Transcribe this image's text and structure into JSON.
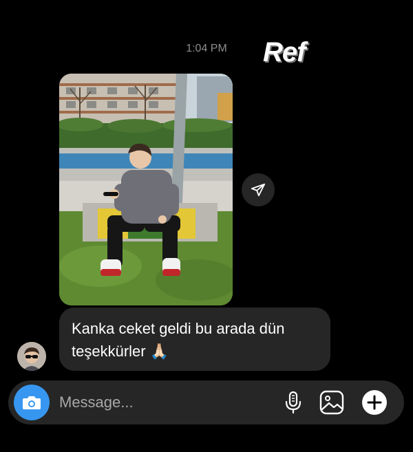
{
  "thread": {
    "timestamp": "1:04 PM",
    "sticker_text": "Ref",
    "shared_post": {
      "type": "photo",
      "share_icon": "paper-plane-icon"
    },
    "message": {
      "text": "Kanka ceket geldi bu arada dün teşekkürler 🙏🏻"
    },
    "avatar": "user-avatar"
  },
  "composer": {
    "placeholder": "Message...",
    "camera_icon": "camera-icon",
    "mic_icon": "microphone-icon",
    "gallery_icon": "gallery-icon",
    "add_icon": "plus-icon"
  },
  "colors": {
    "background": "#000000",
    "bubble": "#262626",
    "accent": "#3797f0",
    "muted_text": "#8e8e93"
  }
}
